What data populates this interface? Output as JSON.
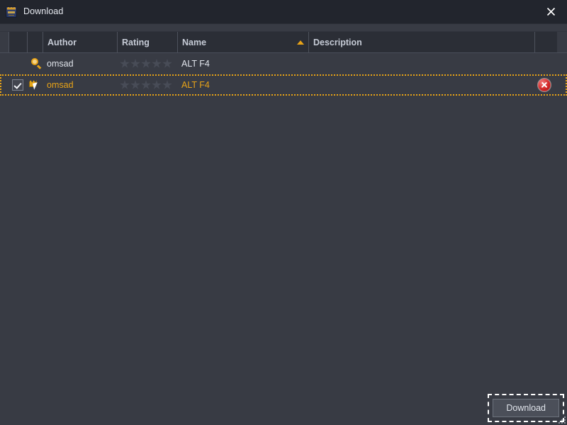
{
  "window": {
    "title": "Download",
    "icon": "app-crest-icon",
    "close_icon": "close-icon",
    "accent_color": "#e8a317",
    "titlebar_bg": "#22252d",
    "body_bg": "#383b44"
  },
  "table": {
    "columns": [
      {
        "key": "check",
        "label": ""
      },
      {
        "key": "icon",
        "label": ""
      },
      {
        "key": "author",
        "label": "Author"
      },
      {
        "key": "rating",
        "label": "Rating"
      },
      {
        "key": "name",
        "label": "Name",
        "sorted": "ascending"
      },
      {
        "key": "desc",
        "label": "Description"
      },
      {
        "key": "delete",
        "label": ""
      }
    ],
    "rows": [
      {
        "checkbox": false,
        "row_icon": "search-icon",
        "author": "omsad",
        "rating": 0,
        "rating_max": 5,
        "name": "ALT F4",
        "description": "",
        "has_delete": false,
        "selected": false
      },
      {
        "checkbox": true,
        "row_icon": "mod-cursor-icon",
        "author": "omsad",
        "rating": 0,
        "rating_max": 5,
        "name": "ALT F4",
        "description": "",
        "has_delete": true,
        "delete_icon": "delete-circle-icon",
        "selected": true
      }
    ]
  },
  "footer": {
    "download_label": "Download",
    "resize_grip": "resize-grip-icon"
  }
}
